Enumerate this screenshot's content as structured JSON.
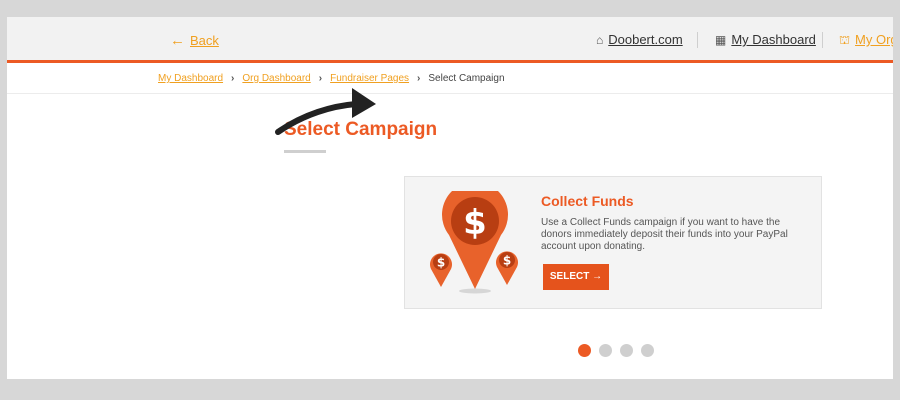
{
  "header": {
    "back_label": "Back",
    "nav": [
      {
        "label": "Doobert.com",
        "icon": "home-icon"
      },
      {
        "label": "My Dashboard",
        "icon": "dashboard-grid-icon"
      },
      {
        "label": "My Org",
        "icon": "bank-icon"
      }
    ]
  },
  "breadcrumb": {
    "items": [
      "My Dashboard",
      "Org Dashboard",
      "Fundraiser Pages"
    ],
    "current": "Select Campaign"
  },
  "page": {
    "title": "Select Campaign"
  },
  "campaign_card": {
    "title": "Collect Funds",
    "description": "Use a Collect Funds campaign if you want to have the donors immediately deposit their funds into your PayPal account upon donating.",
    "button_label": "SELECT →",
    "icon": "money-pin-icon"
  },
  "carousel": {
    "count": 4,
    "active_index": 0
  },
  "colors": {
    "accent": "#ec5a24",
    "link": "#f0a020"
  }
}
